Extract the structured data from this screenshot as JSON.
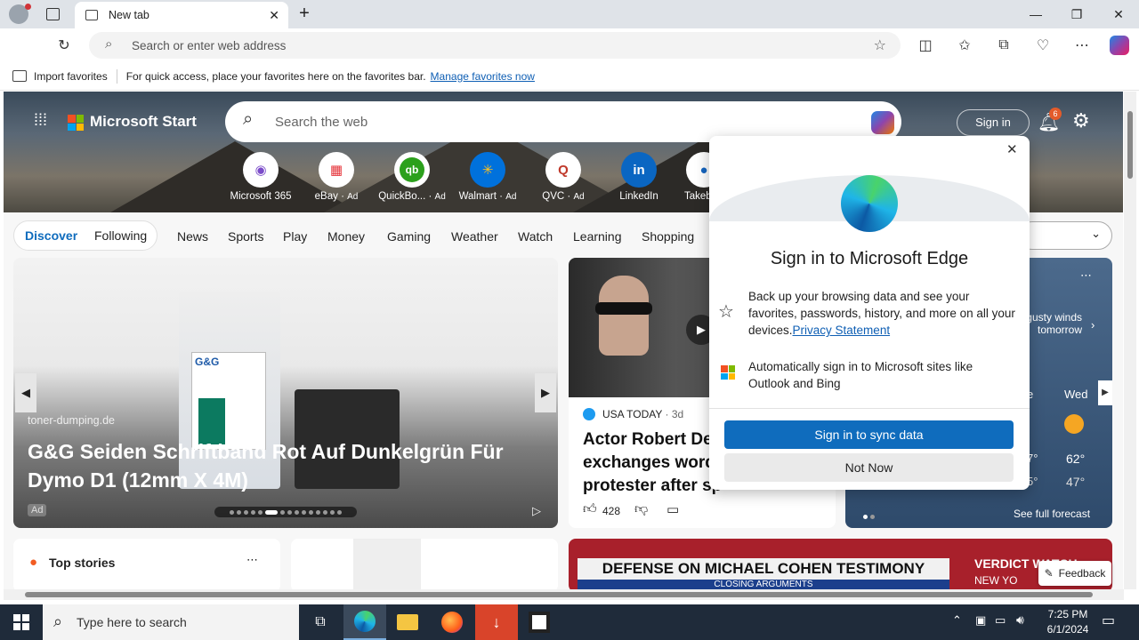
{
  "browser": {
    "tab_title": "New tab",
    "address_placeholder": "Search or enter web address",
    "favorites_bar": {
      "import_label": "Import favorites",
      "message": "For quick access, place your favorites here on the favorites bar.",
      "manage_link": "Manage favorites now"
    }
  },
  "msn": {
    "brand": "Microsoft Start",
    "search_placeholder": "Search the web",
    "sign_in": "Sign in",
    "notification_count": "6",
    "quick_links": [
      {
        "label": "Microsoft 365",
        "ad": ""
      },
      {
        "label": "eBay",
        "ad": "Ad"
      },
      {
        "label": "QuickBo...",
        "ad": "Ad"
      },
      {
        "label": "Walmart",
        "ad": "Ad"
      },
      {
        "label": "QVC",
        "ad": "Ad"
      },
      {
        "label": "LinkedIn",
        "ad": ""
      },
      {
        "label": "Takeb",
        "ad": ""
      }
    ],
    "tabs": [
      "Discover",
      "Following"
    ],
    "nav": [
      "News",
      "Sports",
      "Play",
      "Money",
      "Gaming",
      "Weather",
      "Watch",
      "Learning",
      "Shopping"
    ],
    "hero_card": {
      "source": "toner-dumping.de",
      "title": "G&G Seiden Schriftband Rot Auf Dunkelgrün Für Dymo D1 (12mm X 4M)",
      "ad_badge": "Ad"
    },
    "news_card": {
      "source": "USA TODAY",
      "age": "· 3d",
      "title_l1": "Actor Robert De",
      "title_l2": "exchanges word",
      "title_l3": "protester after sp",
      "likes": "428"
    },
    "weather_card": {
      "wind_note_l1": "gusty winds",
      "wind_note_l2": "tomorrow",
      "day_partial": "e",
      "day": "Wed",
      "high_partial": "7°",
      "low_partial": "5°",
      "high": "62°",
      "low": "47°",
      "forecast_link": "See full forecast"
    },
    "top_stories": "Top stories",
    "video_banner": "DEFENSE ON MICHAEL COHEN TESTIMONY",
    "video_sub": "CLOSING ARGUMENTS",
    "video_right": "VERDICT WATCH",
    "video_right2": "NEW YO",
    "feedback": "Feedback"
  },
  "dialog": {
    "title": "Sign in to Microsoft Edge",
    "item1_text": "Back up your browsing data and see your favorites, passwords, history, and more on all your devices.",
    "item1_link": "Privacy Statement",
    "item2_text": "Automatically sign in to Microsoft sites like Outlook and Bing",
    "primary_button": "Sign in to sync data",
    "secondary_button": "Not Now"
  },
  "taskbar": {
    "search_placeholder": "Type here to search",
    "time": "7:25 PM",
    "date": "6/1/2024"
  },
  "colors": {
    "accent": "#0f6cbd",
    "taskbar": "#1f2b3a"
  }
}
